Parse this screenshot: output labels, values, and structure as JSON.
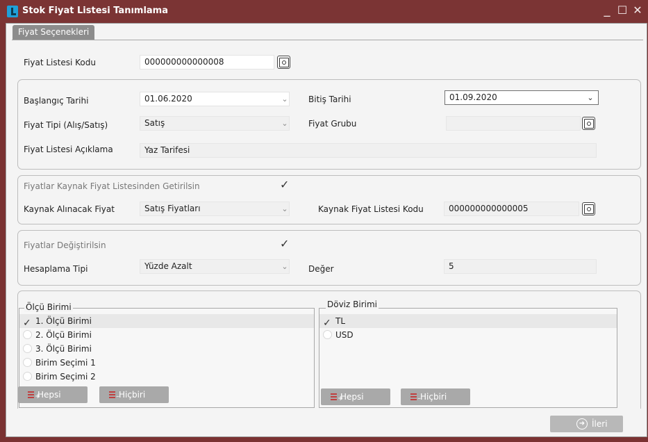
{
  "window": {
    "title": "Stok Fiyat Listesi Tanımlama",
    "minimize": "_",
    "maximize": "☐",
    "close": "✕"
  },
  "tab": {
    "label": "Fiyat Seçenekleri"
  },
  "header": {
    "code_label": "Fiyat Listesi Kodu",
    "code_value": "000000000000008"
  },
  "dates": {
    "start_label": "Başlangıç Tarihi",
    "start_value": "01.06.2020",
    "end_label": "Bitiş Tarihi",
    "end_value": "01.09.2020",
    "type_label": "Fiyat Tipi (Alış/Satış)",
    "type_value": "Satış",
    "group_label": "Fiyat Grubu",
    "group_value": "",
    "desc_label": "Fiyat Listesi Açıklama",
    "desc_value": "Yaz Tarifesi"
  },
  "source": {
    "fetch_label": "Fiyatlar Kaynak Fiyat Listesinden Getirilsin",
    "fetch_checked": true,
    "price_label": "Kaynak Alınacak Fiyat",
    "price_value": "Satış Fiyatları",
    "code_label": "Kaynak Fiyat Listesi Kodu",
    "code_value": "000000000000005"
  },
  "modify": {
    "changed_label": "Fiyatlar Değiştirilsin",
    "changed_checked": true,
    "calc_label": "Hesaplama Tipi",
    "calc_value": "Yüzde Azalt",
    "value_label": "Değer",
    "value_value": "5"
  },
  "units": {
    "title": "Ölçü Birimi",
    "items": [
      {
        "label": "1. Ölçü Birimi",
        "checked": true
      },
      {
        "label": "2. Ölçü Birimi",
        "checked": false
      },
      {
        "label": "3. Ölçü Birimi",
        "checked": false
      },
      {
        "label": "Birim Seçimi 1",
        "checked": false
      },
      {
        "label": "Birim Seçimi 2",
        "checked": false
      }
    ],
    "all_label": "Hepsi",
    "none_label": "Hiçbiri"
  },
  "currency": {
    "title": "Döviz Birimi",
    "items": [
      {
        "label": "TL",
        "checked": true
      },
      {
        "label": "USD",
        "checked": false
      }
    ],
    "all_label": "Hepsi",
    "none_label": "Hiçbiri"
  },
  "footer": {
    "next_label": "İleri"
  },
  "colors": {
    "titlebar": "#7b3434",
    "window_bg": "#f4f4f4",
    "button": "#a9a9a9",
    "accent_red": "#c04040"
  },
  "icons": {
    "app": "app-logo-icon",
    "browse": "browse-icon",
    "combo": "chevron-down-icon",
    "check": "checkmark-icon",
    "select_all": "select-all-icon",
    "select_none": "select-none-icon",
    "next": "arrow-right-circle-icon"
  }
}
